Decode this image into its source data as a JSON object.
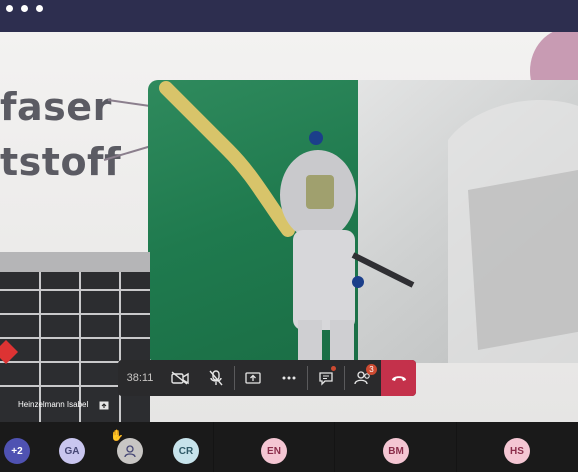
{
  "titlebar": {
    "dots": [
      "dot-1",
      "dot-2",
      "dot-3"
    ]
  },
  "slide": {
    "line1": "faser",
    "line2": "tstoff"
  },
  "controls": {
    "timer": "38:11",
    "participants_badge": "3"
  },
  "presenter": {
    "name": "Heinzelmann Isabel"
  },
  "roster": [
    {
      "initials": "+2",
      "bg": "#4f52b2",
      "fg": "#ffffff"
    },
    {
      "initials": "GA",
      "bg": "#c9c6ef",
      "fg": "#464775"
    },
    {
      "initials": "",
      "bg": "#c8c6c4",
      "fg": "#464775"
    },
    {
      "initials": "CR",
      "bg": "#c7e3eb",
      "fg": "#2f5a67"
    },
    {
      "initials": "EN",
      "bg": "#f4c6d3",
      "fg": "#8a2d4a"
    },
    {
      "initials": "BM",
      "bg": "#f4c6d3",
      "fg": "#8a2d4a"
    },
    {
      "initials": "HS",
      "bg": "#f4c6d3",
      "fg": "#8a2d4a"
    }
  ],
  "colors": {
    "titlebar": "#2d2e4f",
    "leave": "#c4314b",
    "accent_badge": "#cc4a31"
  }
}
